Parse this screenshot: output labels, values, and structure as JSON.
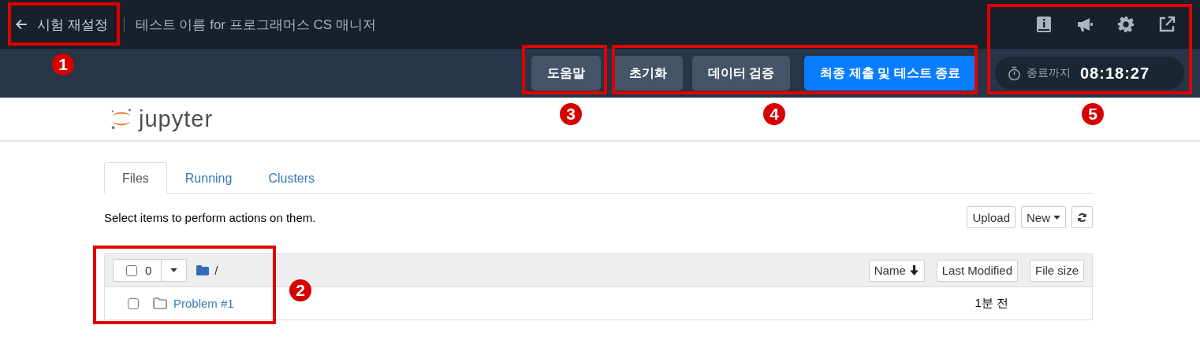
{
  "header": {
    "back_label": "시험 재설정",
    "test_title": "테스트 이름 for 프로그래머스 CS 매니저"
  },
  "toolbar": {
    "buttons": [
      {
        "label": "도움말",
        "kind": "secondary"
      },
      {
        "label": "초기화",
        "kind": "secondary"
      },
      {
        "label": "데이터 검증",
        "kind": "secondary"
      },
      {
        "label": "최종 제출 및 테스트 종료",
        "kind": "primary"
      }
    ],
    "timer": {
      "label": "종료까지",
      "value": "08:18:27"
    }
  },
  "jupyter": {
    "logo_text": "jupyter",
    "tabs": [
      {
        "label": "Files",
        "selected": true
      },
      {
        "label": "Running",
        "selected": false
      },
      {
        "label": "Clusters",
        "selected": false
      }
    ],
    "hint": "Select items to perform actions on them.",
    "actions": [
      {
        "kind": "text",
        "label": "Upload"
      },
      {
        "kind": "dropdown",
        "label": "New"
      },
      {
        "kind": "refresh"
      }
    ],
    "list": {
      "select_all": {
        "checked": false,
        "count": "0"
      },
      "path": "/",
      "columns": [
        {
          "label": "Name",
          "sorted": true
        },
        {
          "label": "Last Modified",
          "sorted": false
        },
        {
          "label": "File size",
          "sorted": false
        }
      ],
      "items": [
        {
          "name": "Problem #1",
          "modified": "1분 전",
          "checked": false
        }
      ]
    }
  },
  "annotations": [
    {
      "label": "1"
    },
    {
      "label": "2"
    },
    {
      "label": "3"
    },
    {
      "label": "4"
    },
    {
      "label": "5"
    }
  ]
}
